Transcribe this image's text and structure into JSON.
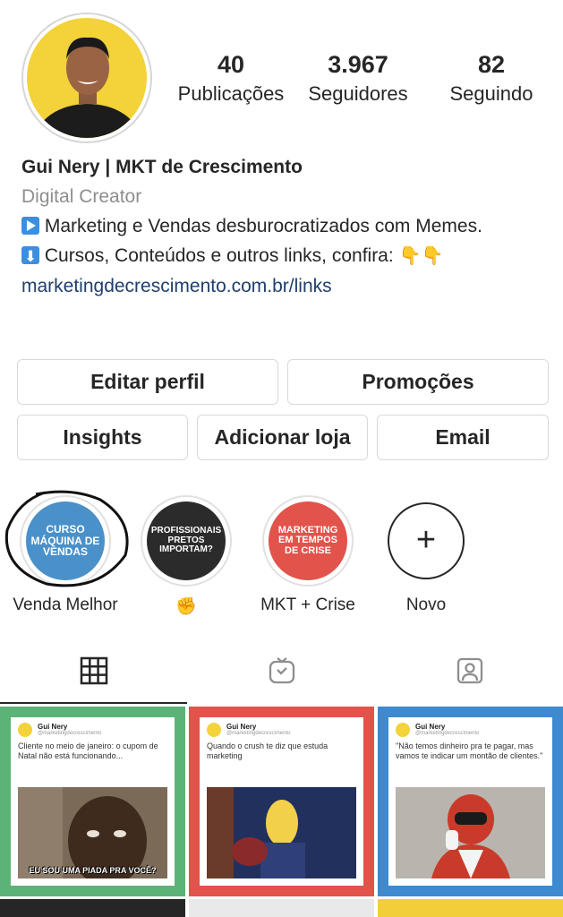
{
  "profile": {
    "stats": [
      {
        "value": "40",
        "label": "Publicações"
      },
      {
        "value": "3.967",
        "label": "Seguidores"
      },
      {
        "value": "82",
        "label": "Seguindo"
      }
    ],
    "name": "Gui Nery | MKT de Crescimento",
    "category": "Digital Creator",
    "bio_line1": "Marketing e Vendas desburocratizados com Memes.",
    "bio_line2": "Cursos, Conteúdos e outros links, confira:",
    "link": "marketingdecrescimento.com.br/links"
  },
  "buttons": {
    "edit": "Editar perfil",
    "promotions": "Promoções",
    "insights": "Insights",
    "add_shop": "Adicionar loja",
    "email": "Email"
  },
  "highlights": [
    {
      "cover": "CURSO MÁQUINA DE VENDAS",
      "label": "Venda Melhor",
      "color": "#4a90c9"
    },
    {
      "cover": "PROFISSIONAIS PRETOS IMPORTAM?",
      "label": "✊",
      "color": "#2b2b2b"
    },
    {
      "cover": "MARKETING EM TEMPOS DE CRISE",
      "label": "MKT + Crise",
      "color": "#e2534b"
    },
    {
      "cover": "+",
      "label": "Novo",
      "color": "#ffffff"
    }
  ],
  "tabs": [
    {
      "icon": "grid-icon",
      "active": true
    },
    {
      "icon": "igtv-icon",
      "active": false
    },
    {
      "icon": "tagged-icon",
      "active": false
    }
  ],
  "posts": [
    {
      "bg": "#5cb377",
      "author": "Gui Nery",
      "handle": "@marketingdecrescimento",
      "text": "Cliente no meio de janeiro: o cupom de Natal não está funcionando...",
      "caption": "EU SOU UMA PIADA PRA VOCÊ?"
    },
    {
      "bg": "#e2534b",
      "author": "Gui Nery",
      "handle": "@marketingdecrescimento",
      "text": "Quando o crush te diz que estuda marketing",
      "caption": ""
    },
    {
      "bg": "#3d8ad0",
      "author": "Gui Nery",
      "handle": "@marketingdecrescimento",
      "text": "\"Não temos dinheiro pra te pagar, mas vamos te indicar um montão de clientes.\"",
      "caption": ""
    }
  ],
  "colors": {
    "avatar_bg": "#f3d23a",
    "link": "#1f3f6e",
    "muted": "#8e8e8e"
  }
}
